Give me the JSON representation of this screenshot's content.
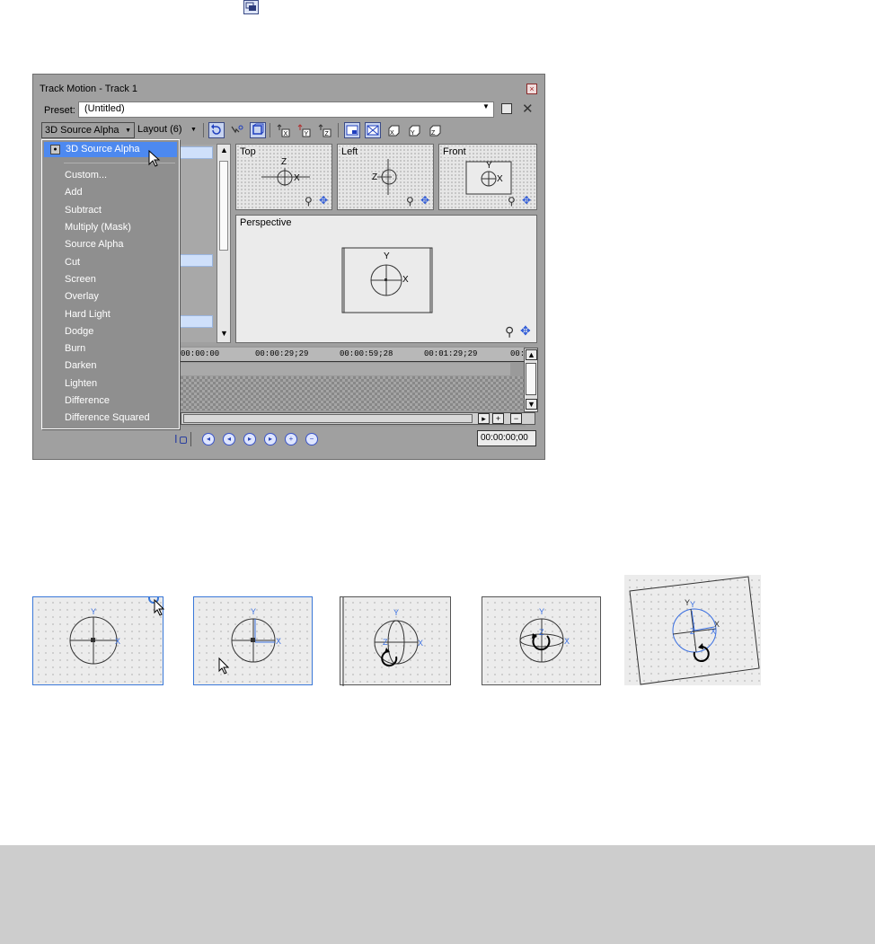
{
  "window": {
    "title": "Track Motion - Track 1",
    "close_glyph": "×",
    "preset_label": "Preset:",
    "preset_value": "(Untitled)",
    "blend_mode": "3D Source Alpha",
    "layout_label": "Layout (6)",
    "toolbar_axes": [
      "X",
      "Y",
      "Z"
    ]
  },
  "viewports": {
    "top": "Top",
    "left": "Left",
    "front": "Front",
    "perspective": "Perspective"
  },
  "axis_letters": {
    "x": "X",
    "y": "Y",
    "z": "Z"
  },
  "timeline": {
    "ticks": [
      "00:00:00",
      "00:00:29;29",
      "00:00:59;28",
      "00:01:29;29",
      "00:"
    ],
    "timecode": "00:00:00;00"
  },
  "menu": {
    "selected": "3D Source Alpha",
    "items": [
      "Custom...",
      "Add",
      "Subtract",
      "Multiply (Mask)",
      "Source Alpha",
      "Cut",
      "Screen",
      "Overlay",
      "Hard Light",
      "Dodge",
      "Burn",
      "Darken",
      "Lighten",
      "Difference",
      "Difference Squared"
    ]
  },
  "colors": {
    "menu_highlight": "#4d89f0",
    "track_row": "#cfe0fb",
    "axis_blue": "#3a6fe0",
    "footer_band": "#cdcdcd"
  },
  "icons": [
    "restore-icon",
    "save-icon",
    "delete-icon",
    "zoom-icon",
    "move-icon",
    "cursor-arrow-icon",
    "rotate-icon"
  ]
}
